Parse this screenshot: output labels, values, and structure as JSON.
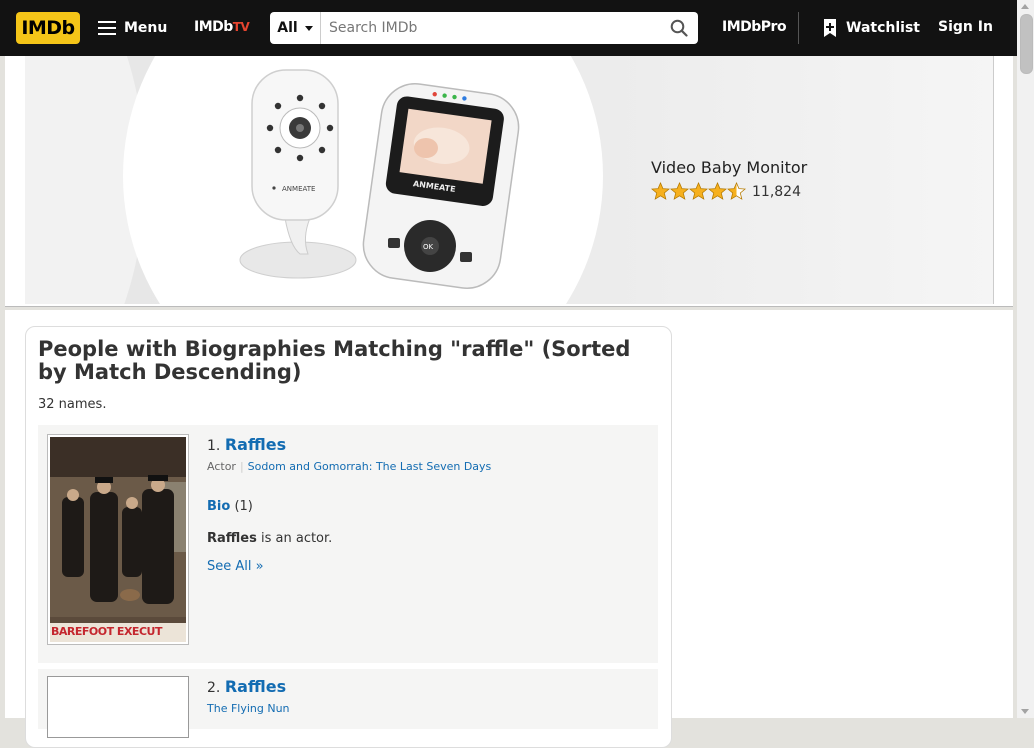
{
  "nav": {
    "logo": "IMDb",
    "menu_label": "Menu",
    "imdbtv_main": "IMDb",
    "imdbtv_suffix": "TV",
    "search_category": "All",
    "search_placeholder": "Search IMDb",
    "imdbpro_label": "IMDbPro",
    "watchlist_label": "Watchlist",
    "signin_label": "Sign In",
    "brand_color": "#f5c518"
  },
  "ad": {
    "product_title": "Video Baby Monitor",
    "rating_stars": 4.5,
    "rating_count": "11,824",
    "camera_brand": "ANMEATE",
    "monitor_brand": "ANMEATE"
  },
  "results": {
    "heading": "People with Biographies Matching \"raffle\" (Sorted by Match Descending)",
    "count_text": "32 names.",
    "items": [
      {
        "rank": "1.",
        "name": "Raffles",
        "role": "Actor",
        "known_for": "Sodom and Gomorrah: The Last Seven Days",
        "bio_label": "Bio",
        "bio_count": "(1)",
        "bio_name": "Raffles",
        "bio_rest": " is an actor.",
        "see_all": "See All »",
        "poster_caption": "BAREFOOT EXECUT"
      },
      {
        "rank": "2.",
        "name": "Raffles",
        "known_for": "The Flying Nun"
      }
    ]
  }
}
